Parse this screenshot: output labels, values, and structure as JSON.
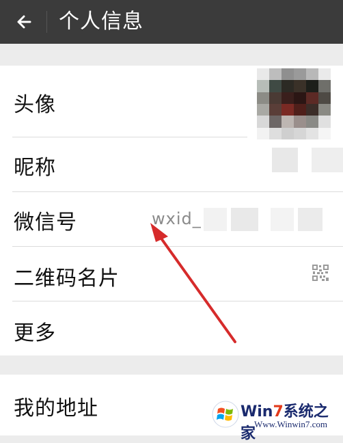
{
  "header": {
    "title": "个人信息",
    "back_icon": "arrow-left-icon"
  },
  "rows": [
    {
      "label": "头像"
    },
    {
      "label": "昵称"
    },
    {
      "label": "微信号",
      "value": "wxid_"
    },
    {
      "label": "二维码名片",
      "icon": "qr-code-icon"
    },
    {
      "label": "更多"
    }
  ],
  "rows2": [
    {
      "label": "我的地址"
    }
  ],
  "watermark": {
    "brand_prefix": "Win",
    "brand_seven": "7",
    "brand_suffix": "系统之家",
    "url": "Www.Winwin7.com"
  },
  "colors": {
    "topbar": "#3b3b3b",
    "background": "#ececec",
    "arrow": "#d62b2b"
  }
}
